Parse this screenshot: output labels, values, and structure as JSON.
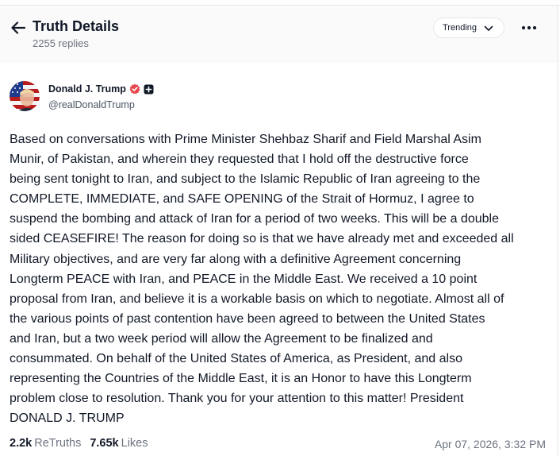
{
  "header": {
    "back_icon": "arrow-left-icon",
    "title": "Truth Details",
    "replies": "2255 replies",
    "sort_label": "Trending",
    "sort_icon": "chevron-down-icon",
    "more_icon": "more-horizontal-icon"
  },
  "post": {
    "author": {
      "name": "Donald J. Trump",
      "handle": "@realDonaldTrump",
      "verified_icon": "verified-badge-icon",
      "verified_color": "#e5484d",
      "plus_icon": "plus-badge-icon"
    },
    "body": "Based on conversations with Prime Minister Shehbaz Sharif and Field Marshal Asim\nMunir, of Pakistan, and wherein they requested that I hold off the destructive force\nbeing sent tonight to Iran, and subject to the Islamic Republic of Iran agreeing to the\nCOMPLETE, IMMEDIATE, and SAFE OPENING of the Strait of Hormuz, I agree to\nsuspend the bombing and attack of Iran for a period of two weeks. This will be a double\nsided CEASEFIRE! The reason for doing so is that we have already met and exceeded all\nMilitary objectives, and are very far along with a definitive Agreement concerning\nLongterm PEACE with Iran, and PEACE in the Middle East. We received a 10 point\nproposal from Iran, and believe it is a workable basis on which to negotiate. Almost all of\nthe various points of past contention have been agreed to between the United States\nand Iran, but a two week period will allow the Agreement to be finalized and\nconsummated. On behalf of the United States of America, as President, and also\nrepresenting the Countries of the Middle East, it is an Honor to have this Longterm\nproblem close to resolution. Thank you for your attention to this matter! President\nDONALD J. TRUMP",
    "stats": {
      "retruths_count": "2.2k",
      "retruths_label": "ReTruths",
      "likes_count": "7.65k",
      "likes_label": "Likes"
    },
    "timestamp": "Apr 07, 2026, 3:32 PM"
  }
}
